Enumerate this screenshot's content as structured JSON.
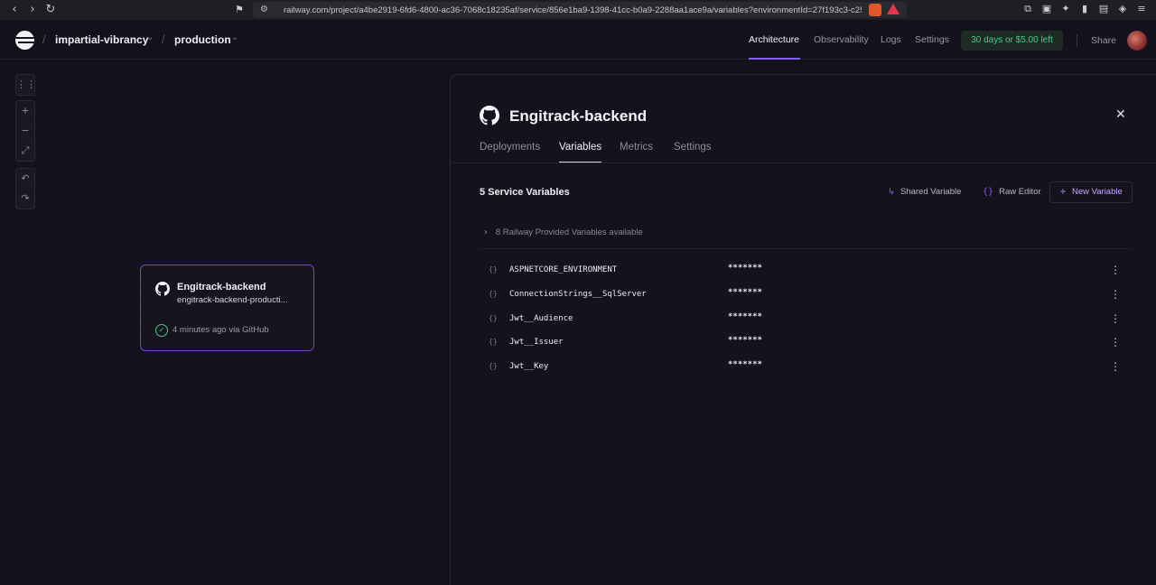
{
  "browser": {
    "url": "railway.com/project/a4be2919-6fd6-4800-ac36-7068c18235af/service/856e1ba9-1398-41cc-b0a9-2288aa1ace9a/variables?environmentId=27f193c3-c25..."
  },
  "header": {
    "project": "impartial-vibrancy",
    "environment": "production",
    "nav": [
      "Architecture",
      "Observability",
      "Logs",
      "Settings"
    ],
    "trial": "30 days or $5.00 left",
    "share": "Share"
  },
  "canvas": {
    "service_card": {
      "name": "Engitrack-backend",
      "domain": "engitrack-backend-producti...",
      "status": "4 minutes ago via GitHub"
    }
  },
  "panel": {
    "title": "Engitrack-backend",
    "tabs": [
      "Deployments",
      "Variables",
      "Metrics",
      "Settings"
    ],
    "active_tab": "Variables",
    "count_label": "5 Service Variables",
    "actions": {
      "shared": "Shared Variable",
      "raw": "Raw Editor",
      "new": "New Variable"
    },
    "provided": "8 Railway Provided Variables available",
    "variables": [
      {
        "name": "ASPNETCORE_ENVIRONMENT",
        "value": "*******"
      },
      {
        "name": "ConnectionStrings__SqlServer",
        "value": "*******"
      },
      {
        "name": "Jwt__Audience",
        "value": "*******"
      },
      {
        "name": "Jwt__Issuer",
        "value": "*******"
      },
      {
        "name": "Jwt__Key",
        "value": "*******"
      }
    ]
  },
  "colors": {
    "accent": "#8a5cf6",
    "success": "#3fcf86",
    "background": "#13111c"
  }
}
